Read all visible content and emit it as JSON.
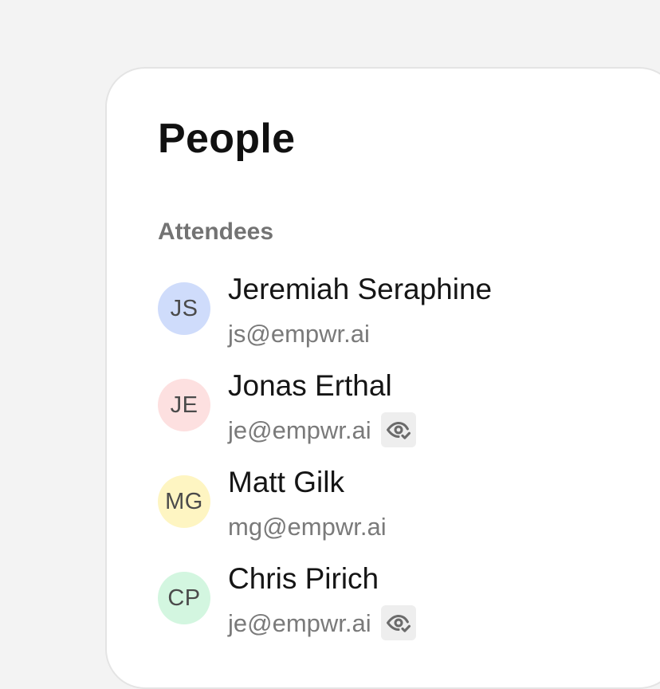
{
  "panel": {
    "title": "People"
  },
  "attendees": {
    "label": "Attendees",
    "people": [
      {
        "initials": "JS",
        "name": "Jeremiah Seraphine",
        "email": "js@empwr.ai",
        "avatar_color": "#cfdcfb",
        "badge_icon": null
      },
      {
        "initials": "JE",
        "name": "Jonas Erthal",
        "email": "je@empwr.ai",
        "avatar_color": "#fde0e0",
        "badge_icon": "eye-check-icon"
      },
      {
        "initials": "MG",
        "name": "Matt Gilk",
        "email": "mg@empwr.ai",
        "avatar_color": "#fef5c2",
        "badge_icon": null
      },
      {
        "initials": "CP",
        "name": "Chris Pirich",
        "email": "je@empwr.ai",
        "avatar_color": "#d3f6e0",
        "badge_icon": "eye-check-icon"
      }
    ]
  }
}
